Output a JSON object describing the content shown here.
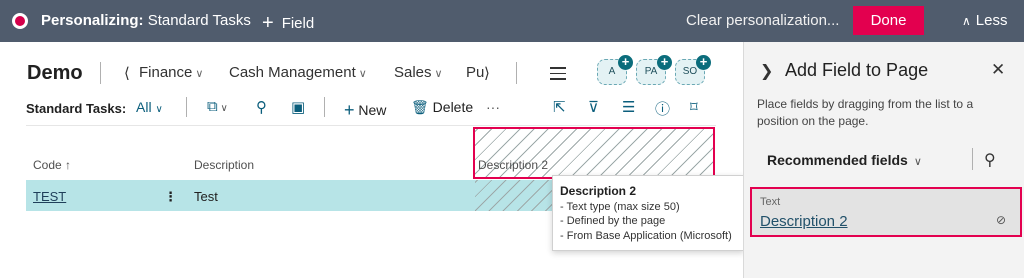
{
  "topbar": {
    "mode_label": "Personalizing:",
    "page_name": "Standard Tasks",
    "add_field_label": "Field",
    "clear_label": "Clear personalization...",
    "done_label": "Done",
    "less_label": "Less"
  },
  "header": {
    "company": "Demo",
    "nav_items": [
      "Finance",
      "Cash Management",
      "Sales",
      "Pu"
    ],
    "avatars": [
      "A",
      "PA",
      "SO"
    ]
  },
  "actions": {
    "page_label": "Standard Tasks:",
    "view_label": "All",
    "new_label": "New",
    "delete_label": "Delete",
    "more_label": "···"
  },
  "grid": {
    "columns": [
      "Code ↑",
      "Description",
      "Description 2"
    ],
    "rows": [
      {
        "code": "TEST",
        "description": "Test",
        "description2": ""
      }
    ]
  },
  "tooltip": {
    "title": "Description 2",
    "lines": [
      "- Text type (max size 50)",
      "- Defined by the page",
      "- From Base Application (Microsoft)"
    ]
  },
  "pane": {
    "title": "Add Field to Page",
    "description": "Place fields by dragging from the list to a position on the page.",
    "filter_label": "Recommended fields",
    "field": {
      "type": "Text",
      "name": "Description 2"
    }
  },
  "colors": {
    "topbar_bg": "#505c6d",
    "accent_red": "#e3004f",
    "selected_row": "#b7e4e7",
    "link_blue": "#22516a"
  }
}
